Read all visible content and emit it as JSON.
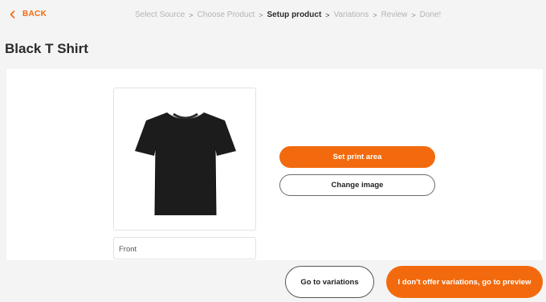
{
  "header": {
    "back_label": "BACK",
    "steps": [
      {
        "label": "Select Source"
      },
      {
        "label": "Choose Product"
      },
      {
        "label": "Setup product"
      },
      {
        "label": "Variations"
      },
      {
        "label": "Review"
      },
      {
        "label": "Done!"
      }
    ],
    "active_step": "Setup product",
    "separator": ">"
  },
  "page": {
    "title": "Black T Shirt"
  },
  "product_image": {
    "icon": "tshirt-image",
    "shirt_color": "#1c1c1c"
  },
  "image_label": "Front",
  "actions": {
    "set_print_area": "Set print area",
    "change_image": "Change image"
  },
  "footer": {
    "go_to_variations": "Go to variations",
    "no_variations": "I don't offer variations, go to preview"
  },
  "colors": {
    "accent": "#f26a0d",
    "background": "#f4f4f4",
    "panel": "#ffffff"
  }
}
